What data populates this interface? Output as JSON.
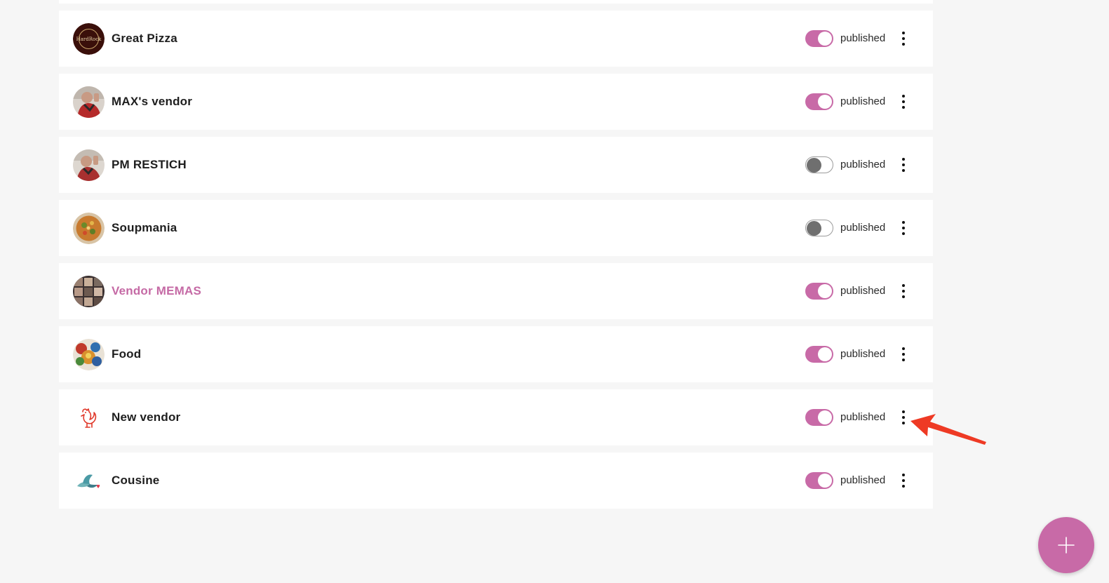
{
  "vendors": [
    {
      "name": "",
      "status": "",
      "published": true
    },
    {
      "name": "Great Pizza",
      "status": "published",
      "published": true,
      "avatar_icon": "hard-rock-logo-icon"
    },
    {
      "name": "MAX's vendor",
      "status": "published",
      "published": true,
      "avatar_icon": "person-photo-icon"
    },
    {
      "name": "PM RESTICH",
      "status": "published",
      "published": false,
      "avatar_icon": "person-photo-icon"
    },
    {
      "name": "Soupmania",
      "status": "published",
      "published": false,
      "avatar_icon": "soup-bowl-icon"
    },
    {
      "name": "Vendor MEMAS",
      "status": "published",
      "published": true,
      "avatar_icon": "collage-photo-icon",
      "highlighted": true
    },
    {
      "name": "Food",
      "status": "published",
      "published": true,
      "avatar_icon": "food-photo-icon"
    },
    {
      "name": "New vendor",
      "status": "published",
      "published": true,
      "avatar_icon": "rooster-logo-icon"
    },
    {
      "name": "Cousine",
      "status": "published",
      "published": true,
      "avatar_icon": "bird-logo-icon"
    }
  ],
  "colors": {
    "accent": "#c86aa7",
    "highlight_text": "#c56aa5",
    "toggle_off_knob": "#6f6f6f",
    "arrow": "#ee3a24",
    "background": "#f6f6f6"
  },
  "fab": {
    "icon": "plus-icon"
  }
}
